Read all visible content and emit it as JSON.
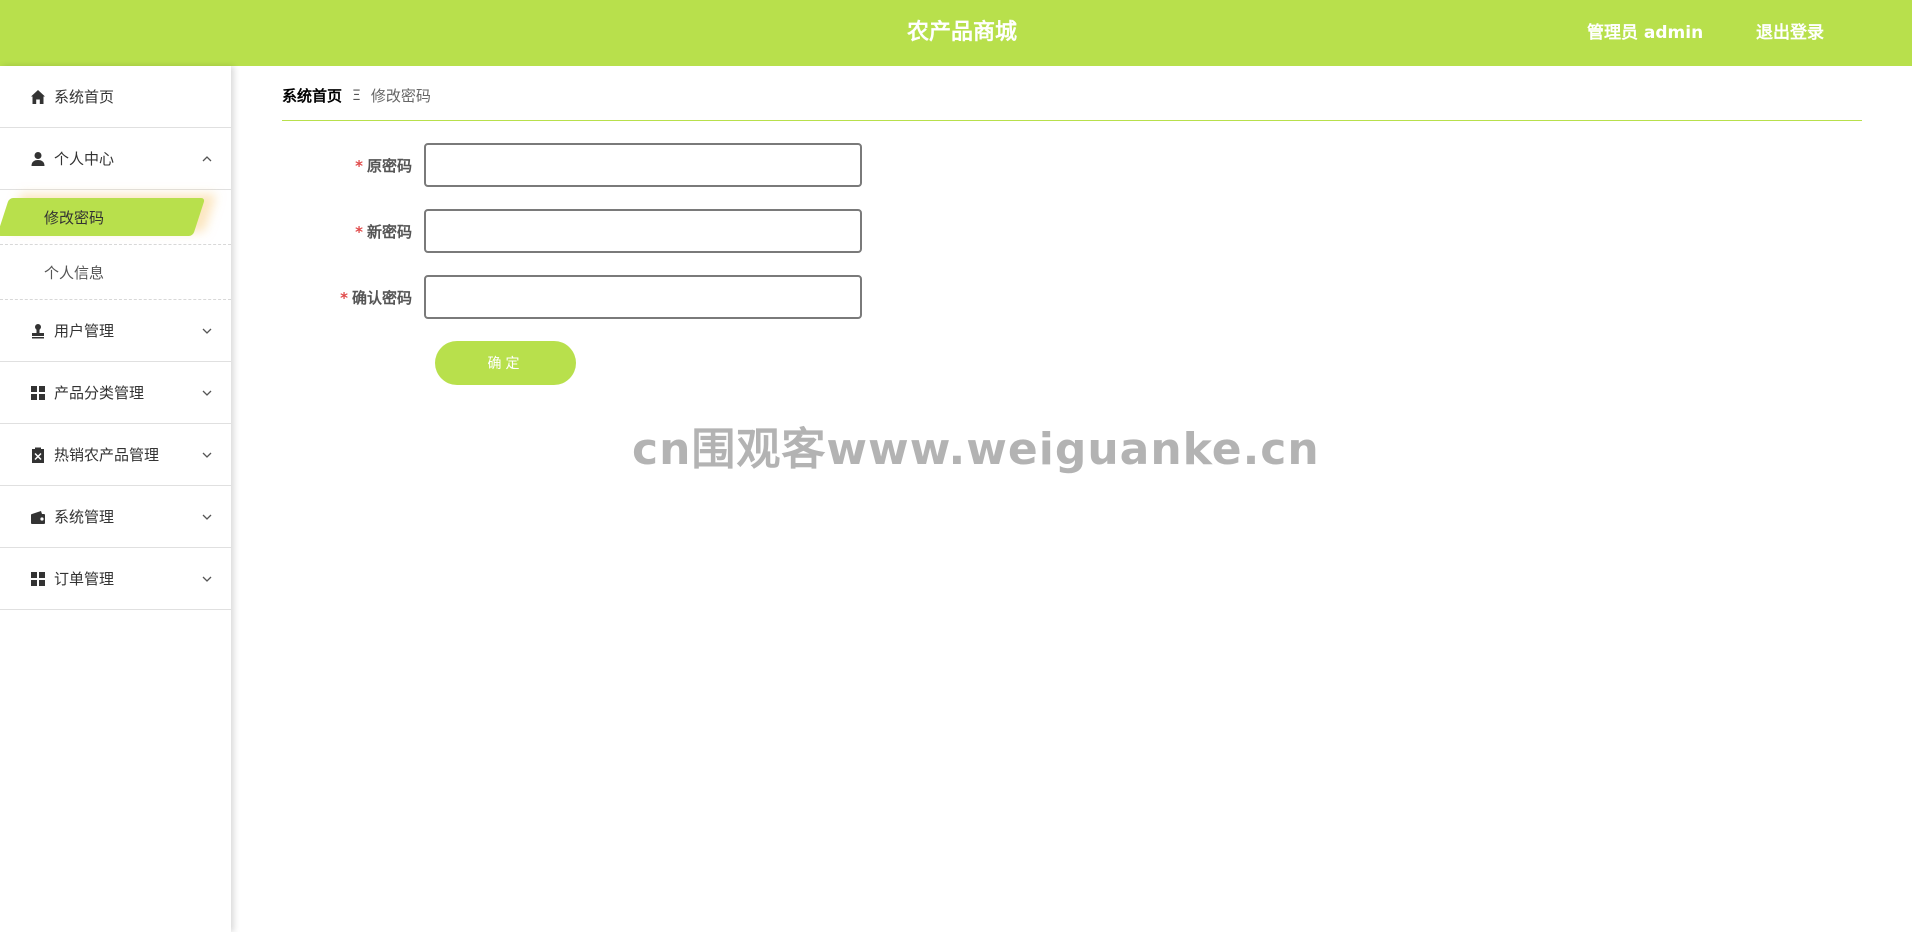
{
  "header": {
    "title": "农产品商城",
    "admin_label": "管理员 admin",
    "logout_label": "退出登录"
  },
  "sidebar": {
    "items": [
      {
        "label": "系统首页",
        "icon": "home-icon"
      },
      {
        "label": "个人中心",
        "icon": "user-icon",
        "expanded": true,
        "children": [
          {
            "label": "修改密码",
            "active": true
          },
          {
            "label": "个人信息"
          }
        ]
      },
      {
        "label": "用户管理",
        "icon": "stamp-icon"
      },
      {
        "label": "产品分类管理",
        "icon": "grid-icon"
      },
      {
        "label": "热销农产品管理",
        "icon": "clipboard-icon"
      },
      {
        "label": "系统管理",
        "icon": "wallet-icon"
      },
      {
        "label": "订单管理",
        "icon": "grid-icon"
      }
    ]
  },
  "breadcrumb": {
    "home": "系统首页",
    "separator": "Ξ",
    "current": "修改密码"
  },
  "form": {
    "required_mark": "*",
    "fields": [
      {
        "label": "原密码",
        "value": ""
      },
      {
        "label": "新密码",
        "value": ""
      },
      {
        "label": "确认密码",
        "value": ""
      }
    ],
    "submit_label": "确定"
  },
  "watermark": "cn围观客www.weiguanke.cn",
  "colors": {
    "accent": "#b8e04c",
    "required": "#e04a4a"
  }
}
